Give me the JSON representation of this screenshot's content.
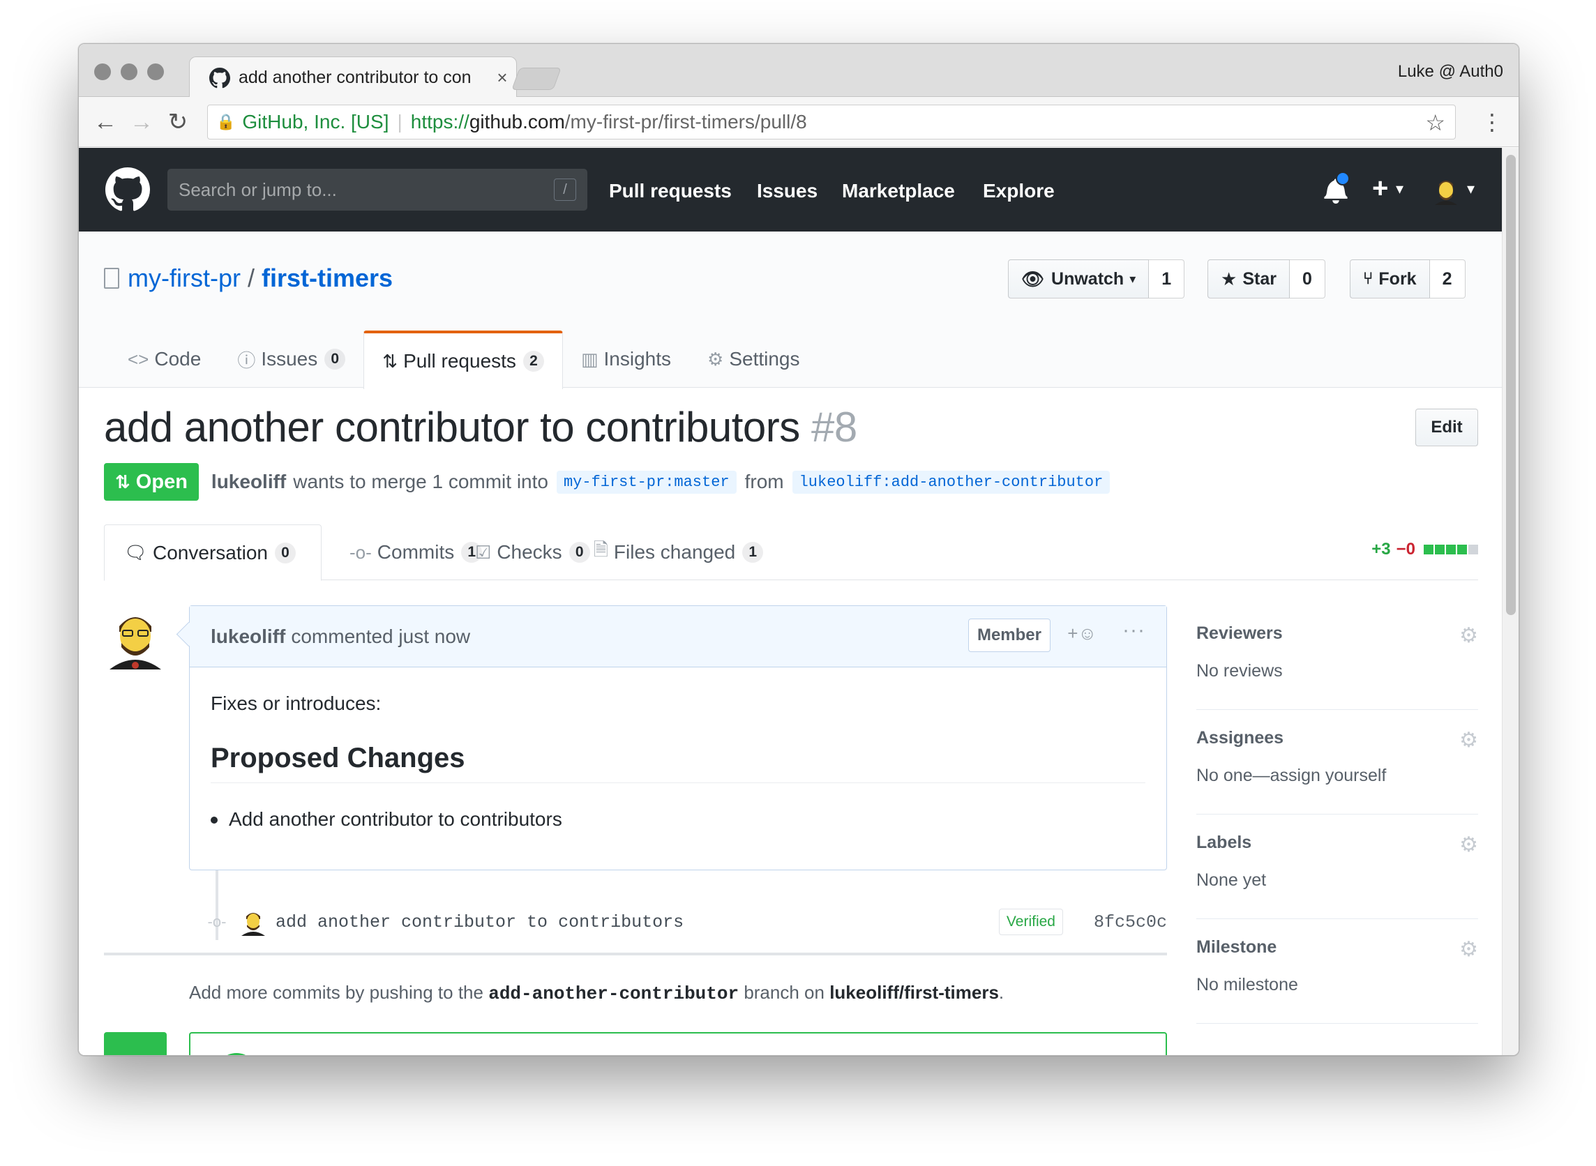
{
  "browser": {
    "tab_title": "add another contributor to con",
    "tab_close": "×",
    "profile_name": "Luke @ Auth0",
    "back_icon": "←",
    "forward_icon": "→",
    "reload_icon": "↻",
    "org": "GitHub, Inc. [US]",
    "url_scheme": "https://",
    "url_host": "github.com",
    "url_path": "/my-first-pr/first-timers/pull/8",
    "star_icon": "☆",
    "menu_icon": "⋮"
  },
  "gh_header": {
    "search_placeholder": "Search or jump to...",
    "search_shortcut": "/",
    "nav": [
      "Pull requests",
      "Issues",
      "Marketplace",
      "Explore"
    ],
    "plus_label": "+",
    "caret": "▾"
  },
  "repo": {
    "owner": "my-first-pr",
    "separator": "/",
    "name": "first-timers",
    "watch_label": "Unwatch",
    "watch_count": "1",
    "star_label": "Star",
    "star_count": "0",
    "fork_label": "Fork",
    "fork_count": "2",
    "tabs": [
      {
        "label": "Code",
        "icon": "<>",
        "count": ""
      },
      {
        "label": "Issues",
        "icon": "ⓘ",
        "count": "0"
      },
      {
        "label": "Pull requests",
        "icon": "⇅",
        "count": "2"
      },
      {
        "label": "Insights",
        "icon": "▥",
        "count": ""
      },
      {
        "label": "Settings",
        "icon": "⚙",
        "count": ""
      }
    ]
  },
  "pr": {
    "title": "add another contributor to contributors",
    "number": "#8",
    "edit_label": "Edit",
    "state": "Open",
    "author": "lukeoliff",
    "merge_text": "wants to merge 1 commit into",
    "base_ref": "my-first-pr:master",
    "from_text": "from",
    "head_ref": "lukeoliff:add-another-contributor",
    "tabs": [
      {
        "label": "Conversation",
        "count": "0"
      },
      {
        "label": "Commits",
        "count": "1"
      },
      {
        "label": "Checks",
        "count": "0"
      },
      {
        "label": "Files changed",
        "count": "1"
      }
    ],
    "additions": "+3",
    "deletions": "−0",
    "diff_colors": [
      "#2cbe4e",
      "#2cbe4e",
      "#2cbe4e",
      "#2cbe4e",
      "#d1d5da"
    ]
  },
  "comment": {
    "author": "lukeoliff",
    "action": "commented just now",
    "badge": "Member",
    "reaction": "+☺",
    "more": "···",
    "intro": "Fixes or introduces:",
    "heading": "Proposed Changes",
    "bullet": "Add another contributor to contributors"
  },
  "commit": {
    "message": "add another contributor to contributors",
    "verified": "Verified",
    "sha": "8fc5c0c"
  },
  "push_note": {
    "prefix": "Add more commits by pushing to the",
    "branch": "add-another-contributor",
    "middle": "branch on",
    "repo": "lukeoliff/first-timers",
    "suffix": "."
  },
  "sidebar": [
    {
      "heading": "Reviewers",
      "value": "No reviews"
    },
    {
      "heading": "Assignees",
      "value": "No one—assign yourself"
    },
    {
      "heading": "Labels",
      "value": "None yet"
    },
    {
      "heading": "Milestone",
      "value": "No milestone"
    }
  ],
  "colors": {
    "header_bg": "#24292e",
    "link": "#0366d6",
    "open_green": "#2cbe4e",
    "tab_accent": "#e36209"
  }
}
